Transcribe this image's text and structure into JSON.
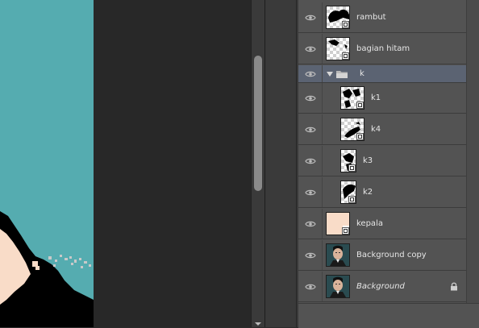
{
  "layers": [
    {
      "name": "rambut",
      "italic": false,
      "visible": true,
      "selected": false,
      "kind": "pixel",
      "thumb": "hair"
    },
    {
      "name": "bagian hitam",
      "italic": false,
      "visible": true,
      "selected": false,
      "kind": "pixel",
      "thumb": "black-part"
    },
    {
      "name": "k",
      "italic": false,
      "visible": true,
      "selected": true,
      "kind": "group",
      "expanded": true
    },
    {
      "name": "k1",
      "italic": false,
      "visible": true,
      "selected": false,
      "kind": "pixel",
      "thumb": "k1",
      "indent": true
    },
    {
      "name": "k4",
      "italic": false,
      "visible": true,
      "selected": false,
      "kind": "pixel",
      "thumb": "k4",
      "indent": true
    },
    {
      "name": "k3",
      "italic": false,
      "visible": true,
      "selected": false,
      "kind": "pixel",
      "thumb": "k3",
      "indent": true
    },
    {
      "name": "k2",
      "italic": false,
      "visible": true,
      "selected": false,
      "kind": "pixel",
      "thumb": "k2",
      "indent": true
    },
    {
      "name": "kepala",
      "italic": false,
      "visible": true,
      "selected": false,
      "kind": "pixel",
      "thumb": "skin"
    },
    {
      "name": "Background copy",
      "italic": false,
      "visible": true,
      "selected": false,
      "kind": "photo",
      "thumb": "photo"
    },
    {
      "name": "Background",
      "italic": true,
      "visible": true,
      "selected": false,
      "kind": "photo",
      "thumb": "photo",
      "locked": true
    }
  ],
  "icons": {
    "visibility": "eye-icon",
    "group": "folder-icon",
    "expand": "triangle-down-icon",
    "lock": "lock-icon",
    "mask-link": "layer-mask-icon"
  },
  "colors": {
    "canvas_teal": "#55acb0",
    "skin": "#f9dcc8",
    "selected_row": "#5b6372",
    "panel_bg": "#535353"
  }
}
